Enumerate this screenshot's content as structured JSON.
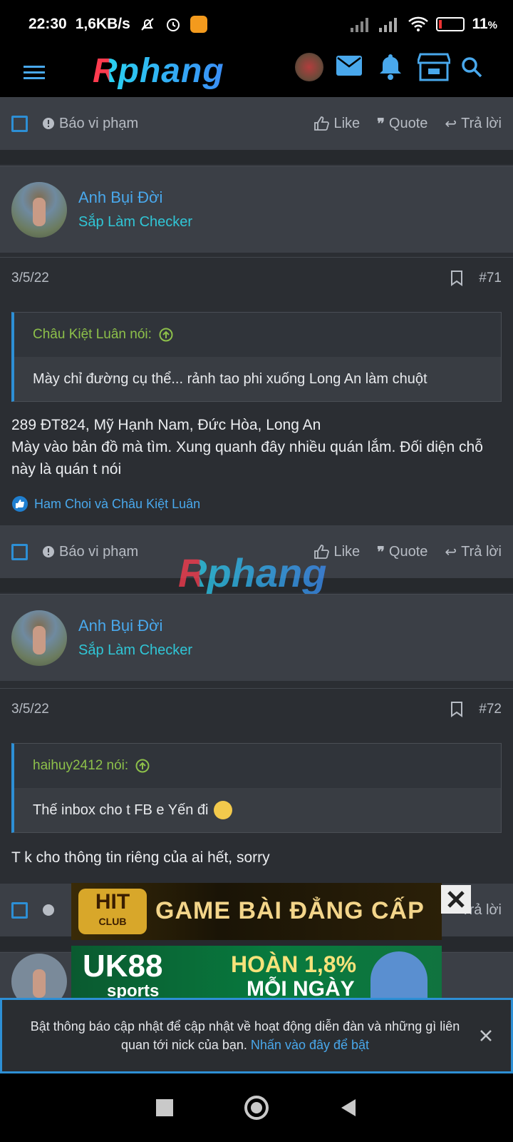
{
  "status": {
    "time": "22:30",
    "net_speed": "1,6KB/s",
    "battery": "11",
    "battery_unit": "%"
  },
  "header": {
    "logo_text": "Rphang"
  },
  "action_bar": {
    "report_label": "Báo vi phạm",
    "like_label": "Like",
    "quote_label": "Quote",
    "reply_label": "Trả lời"
  },
  "posts": [
    {
      "author": "Anh Bụi Đời",
      "user_title": "Sắp Làm Checker",
      "date": "3/5/22",
      "number": "#71",
      "quote_author": "Châu Kiệt Luân nói:",
      "quote_text": "Mày chỉ đường cụ thể... rảnh tao phi xuống Long An làm chuột",
      "body_line1": "289 ĐT824, Mỹ Hạnh Nam, Đức Hòa, Long An",
      "body_line2": "Mày vào bản đồ mà tìm. Xung quanh đây nhiều quán lắm. Đối diện chỗ này là quán t nói",
      "reactions": "Ham Choi và Châu Kiệt Luân"
    },
    {
      "author": "Anh Bụi Đời",
      "user_title": "Sắp Làm Checker",
      "date": "3/5/22",
      "number": "#72",
      "quote_author": "haihuy2412 nói:",
      "quote_text": "Thế inbox cho t FB e Yến đi",
      "body_line1": "T k cho thông tin riêng của ai hết, sorry"
    }
  ],
  "watermark": "Rphang",
  "ads": {
    "ad1_brand": "HIT",
    "ad1_sub": "CLUB",
    "ad1_text": "GAME BÀI ĐẲNG CẤP",
    "ad2_brand": "UK88",
    "ad2_sub": "sports",
    "ad2_text1": "HOÀN 1,8%",
    "ad2_text2": "MỖI NGÀY"
  },
  "notification": {
    "text": "Bật thông báo cập nhật để cập nhật về hoạt động diễn đàn và những gì liên quan tới nick của bạn.",
    "link": "Nhấn vào đây để bật"
  },
  "colors": {
    "accent": "#2d8fd5",
    "username": "#49a8ec",
    "user_title": "#30c6d6",
    "quote_author": "#8dc04a",
    "background": "#2b2e33"
  },
  "icons": [
    "menu-icon",
    "mail-icon",
    "bell-icon",
    "store-icon",
    "search-icon",
    "bookmark-icon",
    "like-icon",
    "quote-icon",
    "reply-icon",
    "report-icon",
    "close-icon"
  ]
}
